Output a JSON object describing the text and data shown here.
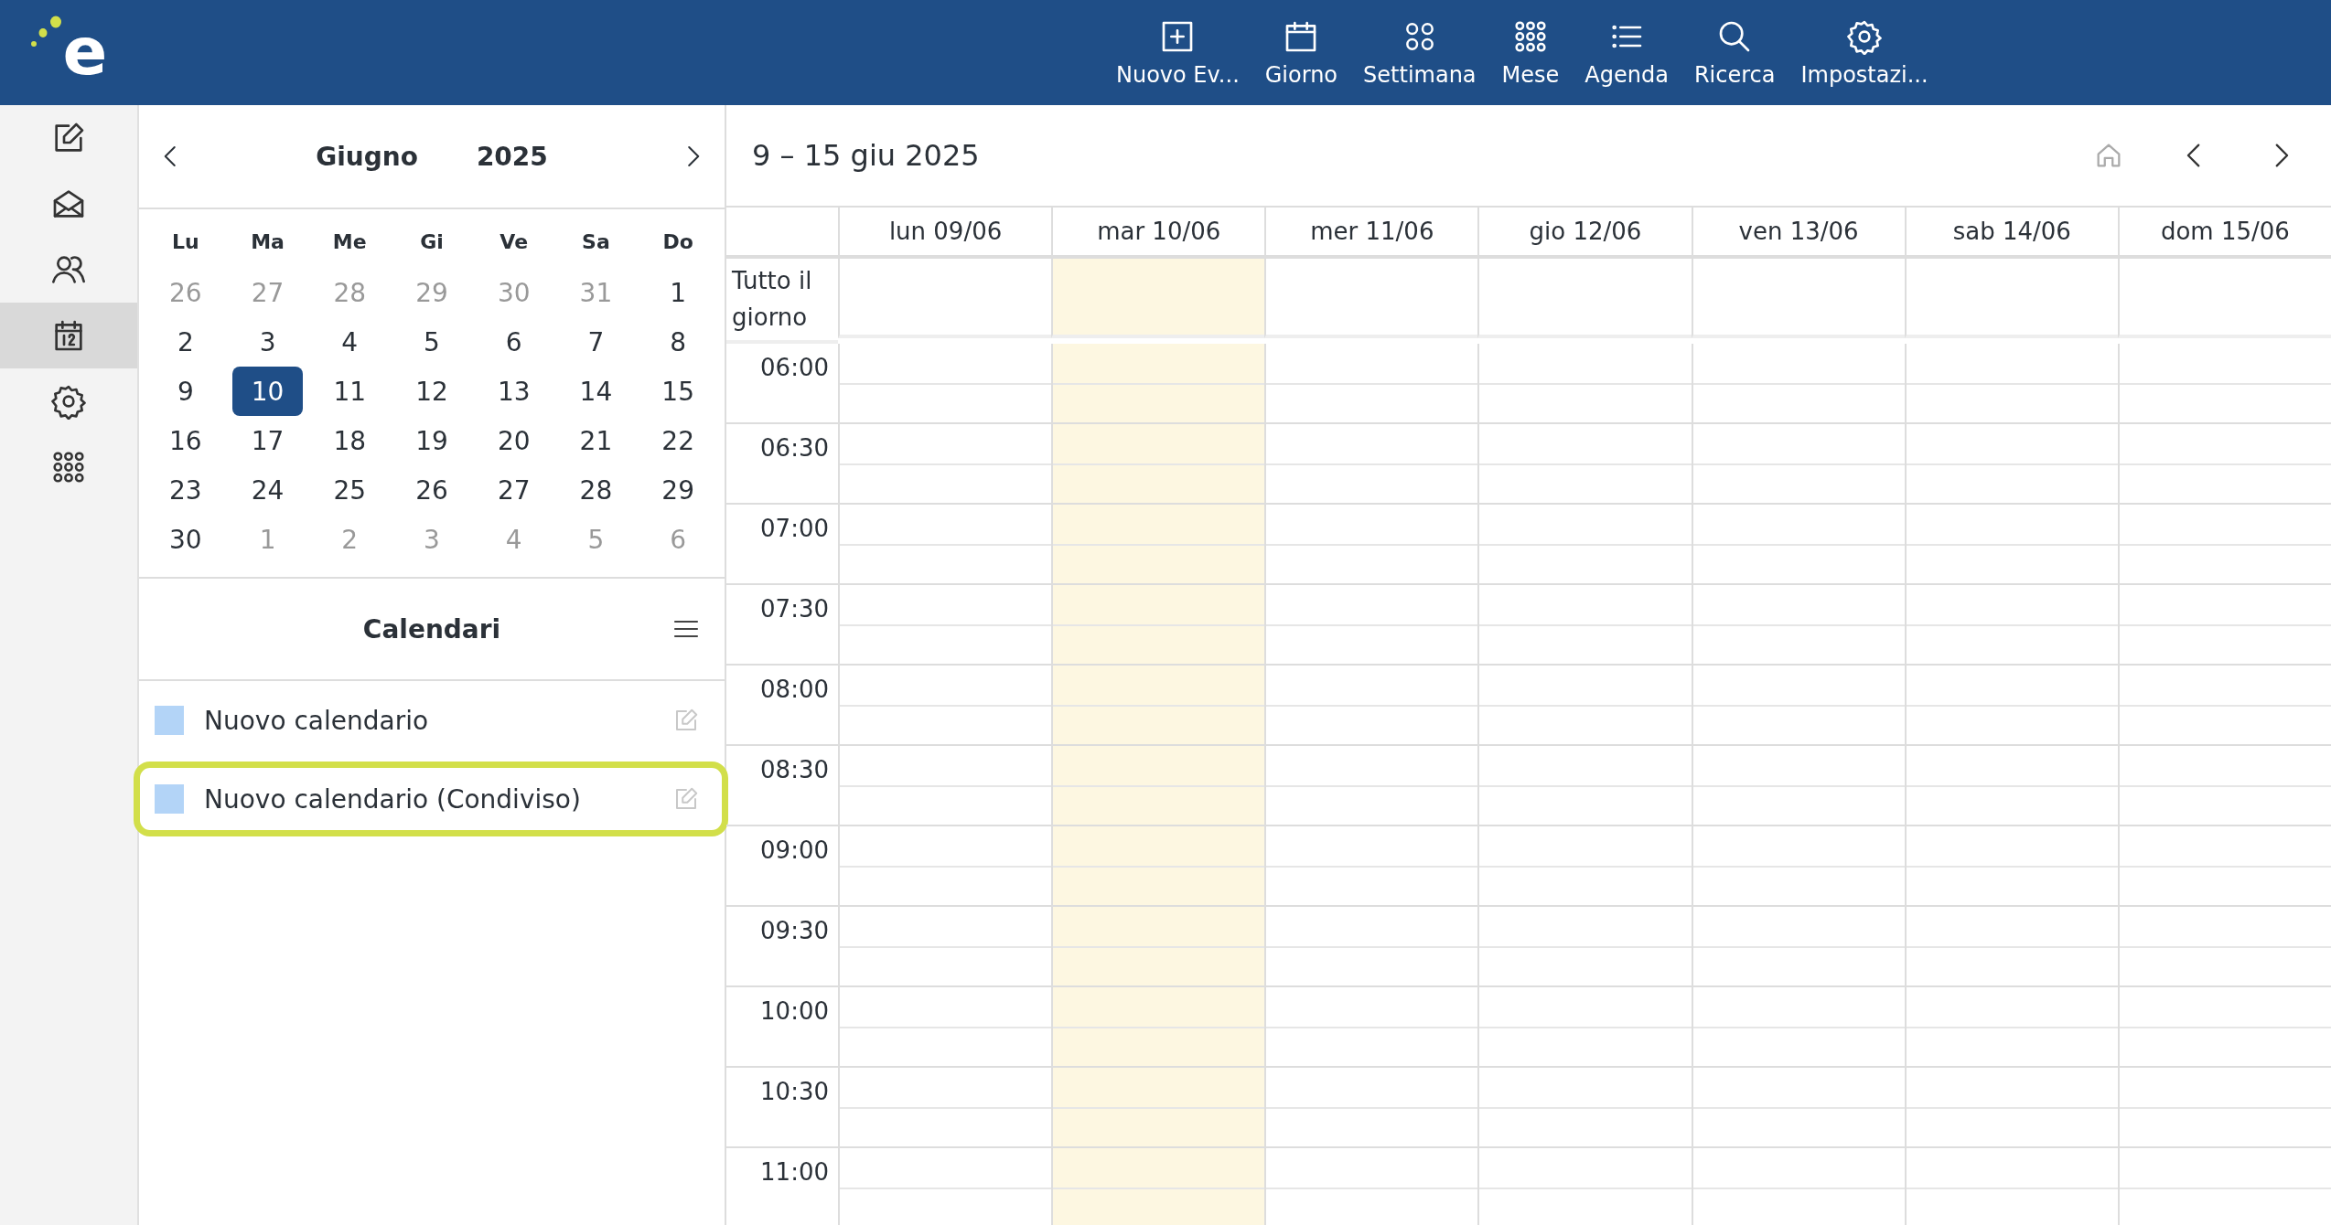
{
  "logo": {
    "letter": "e"
  },
  "toolbar": [
    {
      "kind": "new",
      "label": "Nuovo Ev..."
    },
    {
      "kind": "day",
      "label": "Giorno"
    },
    {
      "kind": "week",
      "label": "Settimana"
    },
    {
      "kind": "month",
      "label": "Mese"
    },
    {
      "kind": "agenda",
      "label": "Agenda"
    },
    {
      "kind": "search",
      "label": "Ricerca"
    },
    {
      "kind": "settings",
      "label": "Impostazi..."
    }
  ],
  "rail": [
    {
      "kind": "compose",
      "selected": false
    },
    {
      "kind": "mail",
      "selected": false
    },
    {
      "kind": "contacts",
      "selected": false
    },
    {
      "kind": "calendar",
      "selected": true
    },
    {
      "kind": "settings",
      "selected": false
    },
    {
      "kind": "apps",
      "selected": false
    }
  ],
  "mini_calendar": {
    "month": "Giugno",
    "year": "2025",
    "weekdays": [
      "Lu",
      "Ma",
      "Me",
      "Gi",
      "Ve",
      "Sa",
      "Do"
    ],
    "weeks": [
      [
        {
          "day": "26",
          "outside": true,
          "selected": false
        },
        {
          "day": "27",
          "outside": true,
          "selected": false
        },
        {
          "day": "28",
          "outside": true,
          "selected": false
        },
        {
          "day": "29",
          "outside": true,
          "selected": false
        },
        {
          "day": "30",
          "outside": true,
          "selected": false
        },
        {
          "day": "31",
          "outside": true,
          "selected": false
        },
        {
          "day": "1",
          "outside": false,
          "selected": false
        }
      ],
      [
        {
          "day": "2",
          "outside": false,
          "selected": false
        },
        {
          "day": "3",
          "outside": false,
          "selected": false
        },
        {
          "day": "4",
          "outside": false,
          "selected": false
        },
        {
          "day": "5",
          "outside": false,
          "selected": false
        },
        {
          "day": "6",
          "outside": false,
          "selected": false
        },
        {
          "day": "7",
          "outside": false,
          "selected": false
        },
        {
          "day": "8",
          "outside": false,
          "selected": false
        }
      ],
      [
        {
          "day": "9",
          "outside": false,
          "selected": false
        },
        {
          "day": "10",
          "outside": false,
          "selected": true
        },
        {
          "day": "11",
          "outside": false,
          "selected": false
        },
        {
          "day": "12",
          "outside": false,
          "selected": false
        },
        {
          "day": "13",
          "outside": false,
          "selected": false
        },
        {
          "day": "14",
          "outside": false,
          "selected": false
        },
        {
          "day": "15",
          "outside": false,
          "selected": false
        }
      ],
      [
        {
          "day": "16",
          "outside": false,
          "selected": false
        },
        {
          "day": "17",
          "outside": false,
          "selected": false
        },
        {
          "day": "18",
          "outside": false,
          "selected": false
        },
        {
          "day": "19",
          "outside": false,
          "selected": false
        },
        {
          "day": "20",
          "outside": false,
          "selected": false
        },
        {
          "day": "21",
          "outside": false,
          "selected": false
        },
        {
          "day": "22",
          "outside": false,
          "selected": false
        }
      ],
      [
        {
          "day": "23",
          "outside": false,
          "selected": false
        },
        {
          "day": "24",
          "outside": false,
          "selected": false
        },
        {
          "day": "25",
          "outside": false,
          "selected": false
        },
        {
          "day": "26",
          "outside": false,
          "selected": false
        },
        {
          "day": "27",
          "outside": false,
          "selected": false
        },
        {
          "day": "28",
          "outside": false,
          "selected": false
        },
        {
          "day": "29",
          "outside": false,
          "selected": false
        }
      ],
      [
        {
          "day": "30",
          "outside": false,
          "selected": false
        },
        {
          "day": "1",
          "outside": true,
          "selected": false
        },
        {
          "day": "2",
          "outside": true,
          "selected": false
        },
        {
          "day": "3",
          "outside": true,
          "selected": false
        },
        {
          "day": "4",
          "outside": true,
          "selected": false
        },
        {
          "day": "5",
          "outside": true,
          "selected": false
        },
        {
          "day": "6",
          "outside": true,
          "selected": false
        }
      ]
    ]
  },
  "calendars": {
    "title": "Calendari",
    "items": [
      {
        "name": "Nuovo calendario",
        "color": "#b3d4f7",
        "highlighted": false
      },
      {
        "name": "Nuovo calendario (Condiviso)",
        "color": "#b3d4f7",
        "highlighted": true
      }
    ]
  },
  "week_view": {
    "range": "9 – 15 giu 2025",
    "days": [
      {
        "label": "lun 09/06",
        "today": false
      },
      {
        "label": "mar 10/06",
        "today": true
      },
      {
        "label": "mer 11/06",
        "today": false
      },
      {
        "label": "gio 12/06",
        "today": false
      },
      {
        "label": "ven 13/06",
        "today": false
      },
      {
        "label": "sab 14/06",
        "today": false
      },
      {
        "label": "dom 15/06",
        "today": false
      }
    ],
    "all_day_label": "Tutto il giorno",
    "times": [
      "06:00",
      "06:30",
      "07:00",
      "07:30",
      "08:00",
      "08:30",
      "09:00",
      "09:30",
      "10:00",
      "10:30",
      "11:00"
    ]
  }
}
